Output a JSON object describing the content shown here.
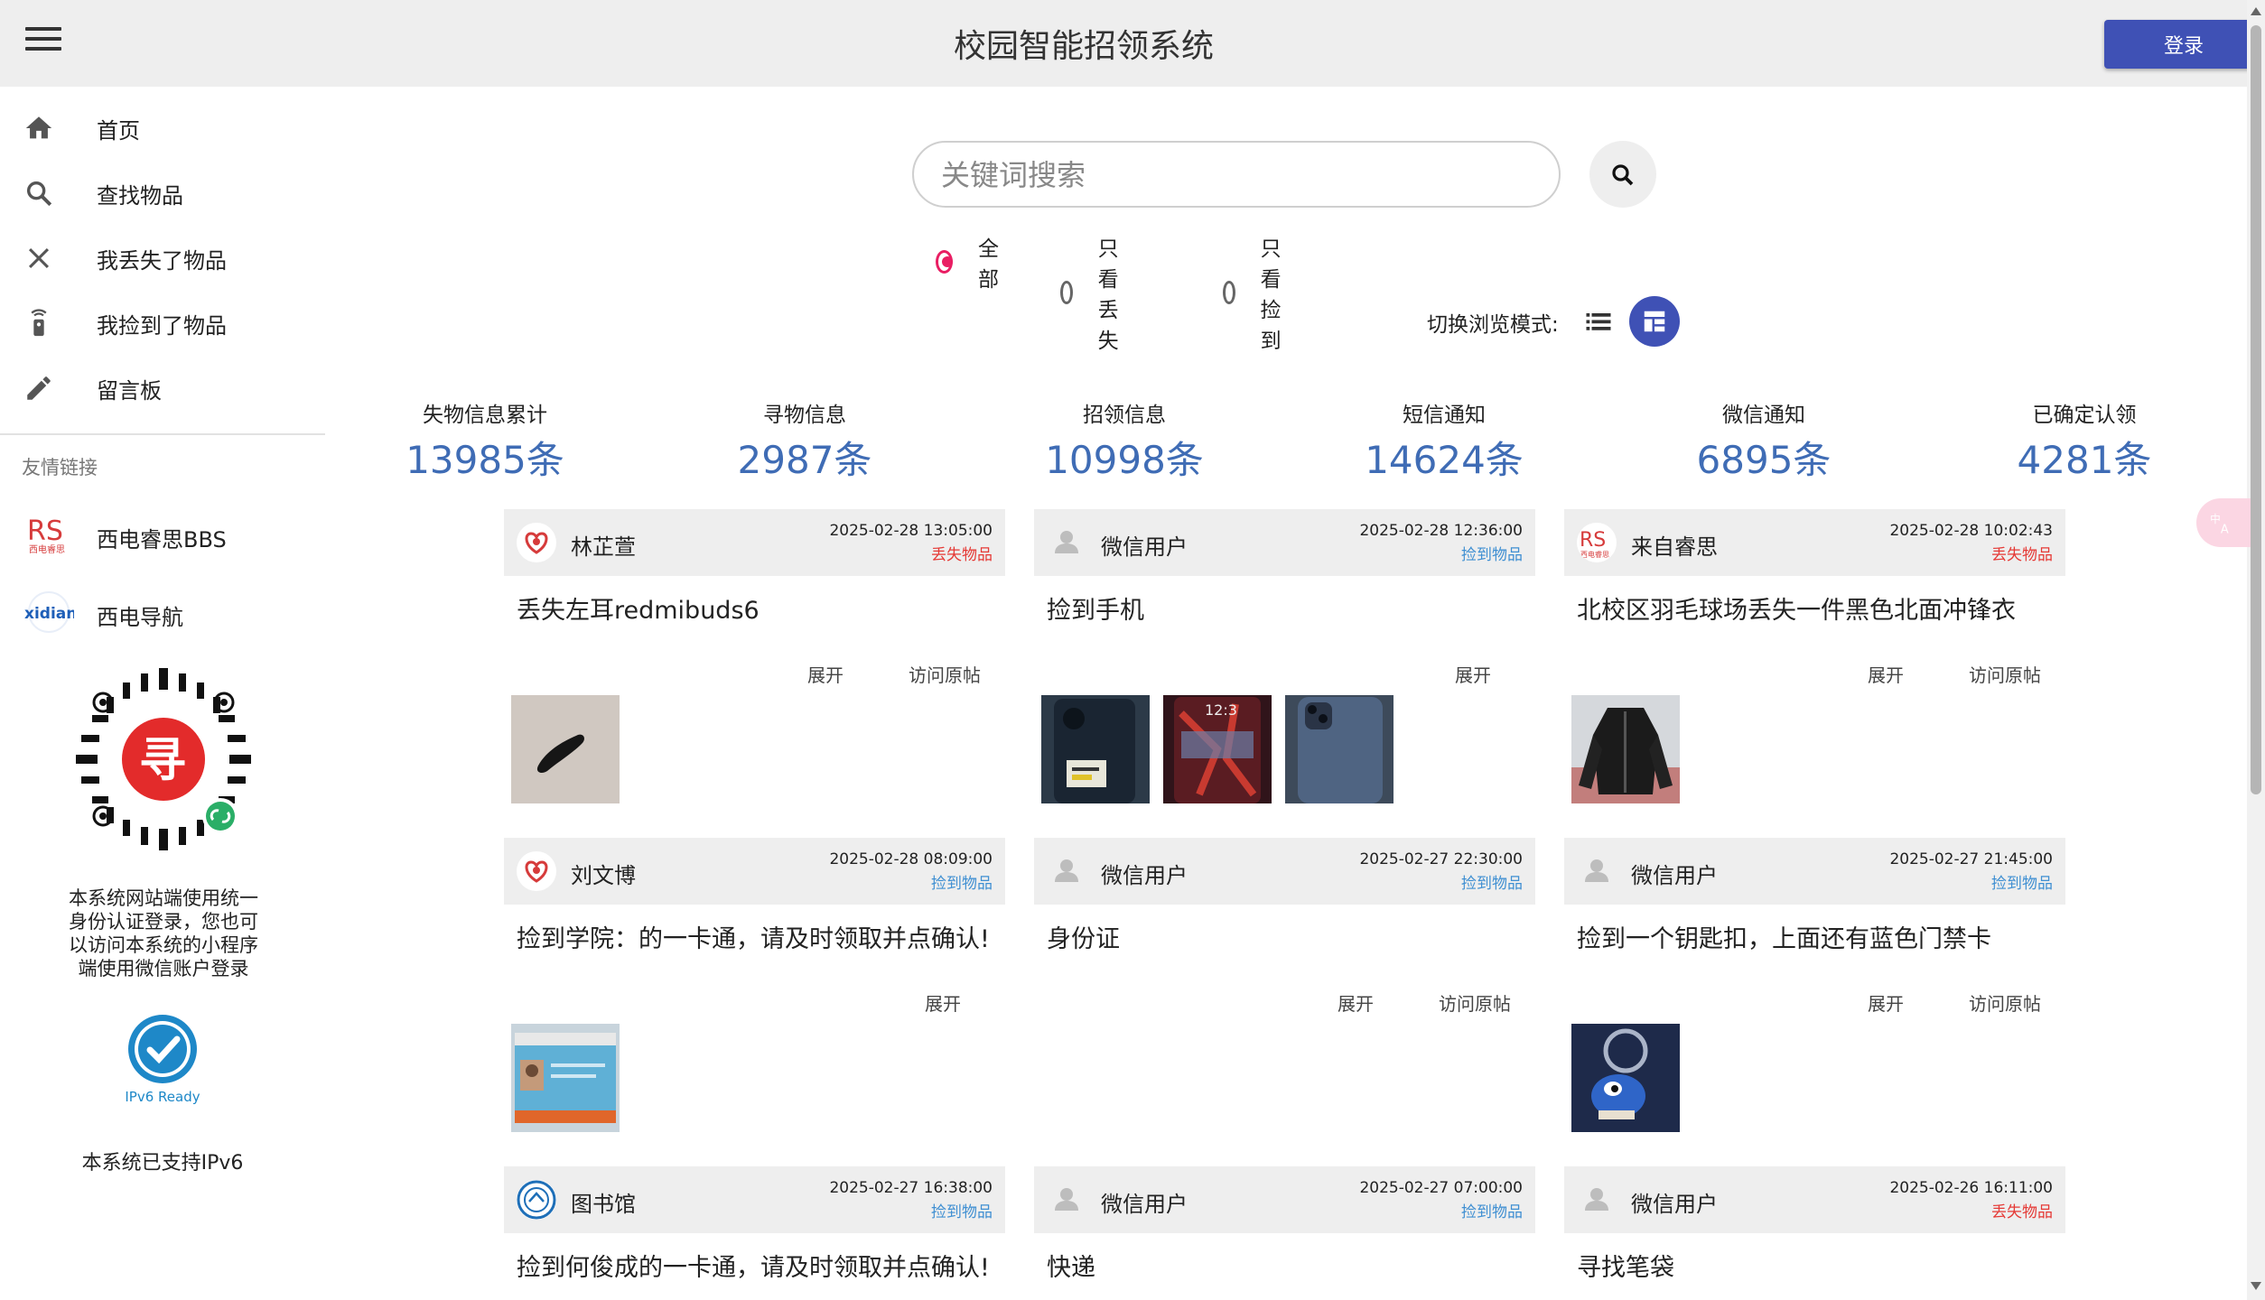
{
  "header": {
    "title": "校园智能招领系统",
    "login_label": "登录"
  },
  "sidebar": {
    "nav": [
      {
        "label": "首页",
        "icon": "home-icon"
      },
      {
        "label": "查找物品",
        "icon": "search-icon"
      },
      {
        "label": "我丢失了物品",
        "icon": "close-icon"
      },
      {
        "label": "我捡到了物品",
        "icon": "pickup-icon"
      },
      {
        "label": "留言板",
        "icon": "pencil-icon"
      }
    ],
    "friends_title": "友情链接",
    "links": [
      {
        "label": "西电睿思BBS",
        "logo": "RS"
      },
      {
        "label": "西电导航",
        "logo": "xidian"
      }
    ],
    "qr_char": "寻",
    "login_note": "本系统网站端使用统一身份认证登录，您也可以访问本系统的小程序端使用微信账户登录",
    "ipv6_logo_text": "IPv6 Ready",
    "ipv6_note": "本系统已支持IPv6"
  },
  "search": {
    "placeholder": "关键词搜索",
    "filters": [
      {
        "label": "全部",
        "selected": true
      },
      {
        "label": "只看丢失",
        "selected": false
      },
      {
        "label": "只看捡到",
        "selected": false
      }
    ],
    "view_mode_label": "切换浏览模式:"
  },
  "stats": [
    {
      "label": "失物信息累计",
      "value": "13985条"
    },
    {
      "label": "寻物信息",
      "value": "2987条"
    },
    {
      "label": "招领信息",
      "value": "10998条"
    },
    {
      "label": "短信通知",
      "value": "14624条"
    },
    {
      "label": "微信通知",
      "value": "6895条"
    },
    {
      "label": "已确定认领",
      "value": "4281条"
    }
  ],
  "posts": [
    {
      "user": "林芷萱",
      "avatar": "heart",
      "date": "2025-02-28 13:05:00",
      "type": "丢失物品",
      "type_kind": "lost",
      "title": "丢失左耳redmibuds6",
      "actions": [
        "展开",
        "访问原帖"
      ],
      "images": [
        "earbud"
      ]
    },
    {
      "user": "微信用户",
      "avatar": "person",
      "date": "2025-02-28 12:36:00",
      "type": "捡到物品",
      "type_kind": "found",
      "title": "捡到手机",
      "actions": [
        "展开"
      ],
      "images": [
        "phone-dark",
        "phone-red",
        "phone-blue"
      ]
    },
    {
      "user": "来自睿思",
      "avatar": "rs",
      "date": "2025-02-28 10:02:43",
      "type": "丢失物品",
      "type_kind": "lost",
      "title": "北校区羽毛球场丢失一件黑色北面冲锋衣",
      "actions": [
        "展开",
        "访问原帖"
      ],
      "images": [
        "jacket"
      ]
    },
    {
      "user": "刘文博",
      "avatar": "heart",
      "date": "2025-02-28 08:09:00",
      "type": "捡到物品",
      "type_kind": "found",
      "title": "捡到学院：的一卡通，请及时领取并点确认!",
      "actions": [
        "展开"
      ],
      "images": [
        "card"
      ]
    },
    {
      "user": "微信用户",
      "avatar": "person",
      "date": "2025-02-27 22:30:00",
      "type": "捡到物品",
      "type_kind": "found",
      "title": "身份证",
      "actions": [
        "展开",
        "访问原帖"
      ],
      "images": []
    },
    {
      "user": "微信用户",
      "avatar": "person",
      "date": "2025-02-27 21:45:00",
      "type": "捡到物品",
      "type_kind": "found",
      "title": "捡到一个钥匙扣，上面还有蓝色门禁卡",
      "actions": [
        "展开",
        "访问原帖"
      ],
      "images": [
        "keychain"
      ]
    },
    {
      "user": "图书馆",
      "avatar": "library",
      "date": "2025-02-27 16:38:00",
      "type": "捡到物品",
      "type_kind": "found",
      "title": "捡到何俊成的一卡通，请及时领取并点确认!",
      "actions": [],
      "images": []
    },
    {
      "user": "微信用户",
      "avatar": "person",
      "date": "2025-02-27 07:00:00",
      "type": "捡到物品",
      "type_kind": "found",
      "title": "快递",
      "actions": [],
      "images": []
    },
    {
      "user": "微信用户",
      "avatar": "person",
      "date": "2025-02-26 16:11:00",
      "type": "丢失物品",
      "type_kind": "lost",
      "title": "寻找笔袋",
      "actions": [],
      "images": []
    }
  ],
  "colors": {
    "primary": "#3f51b5",
    "accent": "#e91e63",
    "lost": "#e53935",
    "found": "#3f8fd2",
    "stat": "#3f6cb5"
  }
}
